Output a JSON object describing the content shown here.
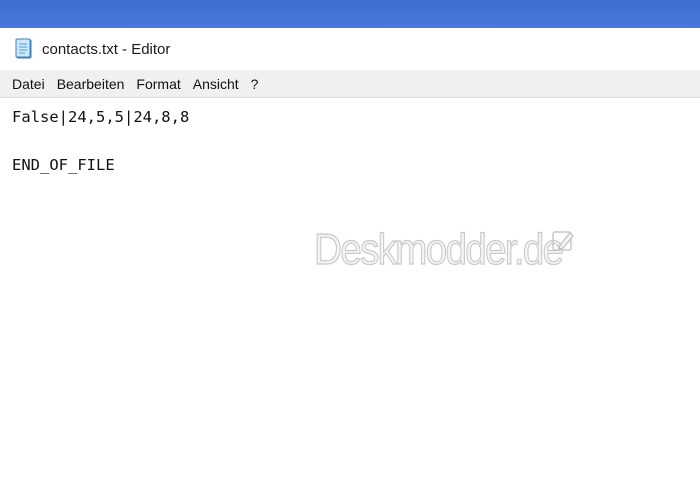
{
  "window": {
    "title": "contacts.txt - Editor",
    "icon": "notepad-icon"
  },
  "menu": {
    "items": [
      "Datei",
      "Bearbeiten",
      "Format",
      "Ansicht",
      "?"
    ]
  },
  "editor": {
    "content": "False|24,5,5|24,8,8\n\nEND_OF_FILE"
  },
  "watermark": {
    "text": "Deskmodder.de",
    "icon": "pen-icon"
  },
  "colors": {
    "desktop": "#4575d8",
    "menubar": "#f0f0f0",
    "text": "#111111"
  }
}
